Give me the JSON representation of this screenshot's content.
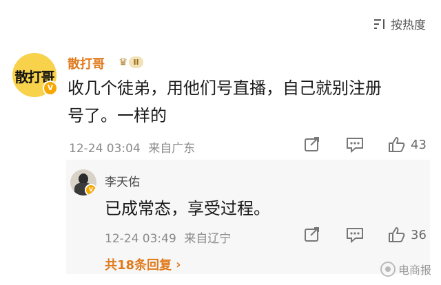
{
  "sort": {
    "label": "按热度",
    "icon": "sort-icon"
  },
  "comment": {
    "avatar_text": "散打哥",
    "author": "散打哥",
    "rank_label": "II",
    "text_line1": "收几个徒弟，用他们号直播，自己就别注册",
    "text_line2": "号了。一样的",
    "time": "12-24 03:04",
    "location": "来自广东",
    "likes": "43"
  },
  "reply": {
    "author": "李天佑",
    "text": "已成常态，享受过程。",
    "time": "12-24 03:49",
    "location": "来自辽宁",
    "likes": "36"
  },
  "replies_total": "共18条回复",
  "watermark": "电商报",
  "colors": {
    "accent": "#e07a1c",
    "muted": "#8a8a8a",
    "badge": "#f7a700"
  }
}
